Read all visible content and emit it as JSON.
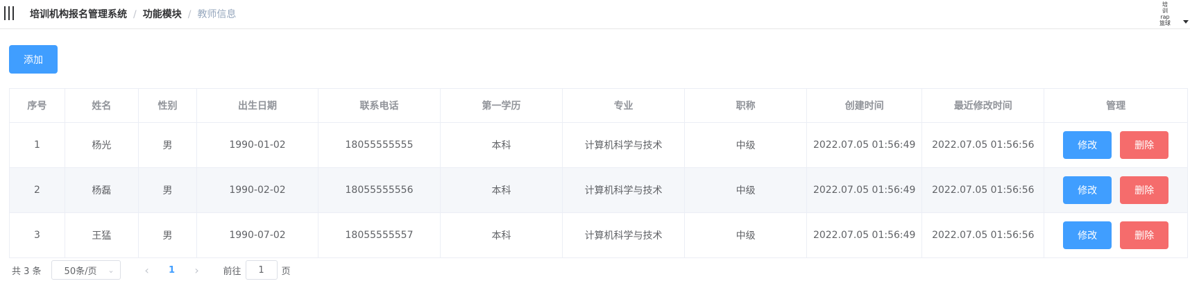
{
  "header": {
    "breadcrumb": [
      "培训机构报名管理系统",
      "功能模块",
      "教师信息"
    ],
    "user_lines": [
      "培",
      "训",
      "rap",
      "篮球"
    ]
  },
  "toolbar": {
    "add_label": "添加"
  },
  "table": {
    "columns": [
      "序号",
      "姓名",
      "性别",
      "出生日期",
      "联系电话",
      "第一学历",
      "专业",
      "职称",
      "创建时间",
      "最近修改时间",
      "管理"
    ],
    "rows": [
      [
        "1",
        "杨光",
        "男",
        "1990-01-02",
        "18055555555",
        "本科",
        "计算机科学与技术",
        "中级",
        "2022.07.05 01:56:49",
        "2022.07.05 01:56:56"
      ],
      [
        "2",
        "杨磊",
        "男",
        "1990-02-02",
        "18055555556",
        "本科",
        "计算机科学与技术",
        "中级",
        "2022.07.05 01:56:49",
        "2022.07.05 01:56:56"
      ],
      [
        "3",
        "王猛",
        "男",
        "1990-07-02",
        "18055555557",
        "本科",
        "计算机科学与技术",
        "中级",
        "2022.07.05 01:56:49",
        "2022.07.05 01:56:56"
      ]
    ],
    "edit_label": "修改",
    "delete_label": "删除"
  },
  "pagination": {
    "total": "共 3 条",
    "page_size": "50条/页",
    "current_page": "1",
    "goto_prefix": "前往",
    "goto_value": "1",
    "goto_suffix": "页"
  },
  "colors": {
    "primary": "#409eff",
    "danger": "#f56c6c",
    "stripe": "#f5f7fa"
  }
}
